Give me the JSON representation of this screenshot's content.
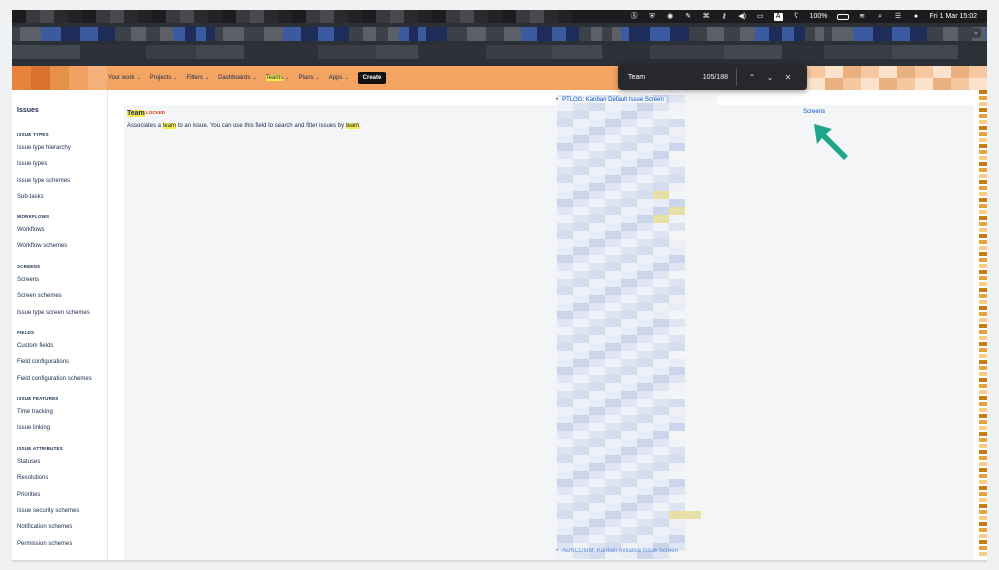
{
  "menubar": {
    "battery": "100%",
    "date_time": "Fri 1 Mar 15:02",
    "status_icons": [
      "s-badge-icon",
      "shield-icon",
      "disc-icon",
      "pin-icon",
      "command-icon",
      "key-icon",
      "volume-icon",
      "battery-icon",
      "keyboard-a-icon",
      "hearing-icon",
      "wifi-icon",
      "search-icon",
      "control-center-icon",
      "siri-icon"
    ],
    "colors": {
      "bg": "#1c1c1e",
      "text": "#ffffff"
    }
  },
  "nav": {
    "items": [
      {
        "label": "Your work",
        "chevron": "⌄",
        "highlighted": false
      },
      {
        "label": "Projects",
        "chevron": "⌄",
        "highlighted": false
      },
      {
        "label": "Filters",
        "chevron": "⌄",
        "highlighted": false
      },
      {
        "label": "Dashboards",
        "chevron": "⌄",
        "highlighted": false
      },
      {
        "label": "Teams",
        "chevron": "⌄",
        "highlighted": true
      },
      {
        "label": "Plans",
        "chevron": "⌄",
        "highlighted": false
      },
      {
        "label": "Apps",
        "chevron": "⌄",
        "highlighted": false
      }
    ],
    "create_label": "Create",
    "colors": {
      "bar": "#f4a462",
      "highlight": "#f6e94a"
    }
  },
  "findbar": {
    "query": "Team",
    "count": "105/188",
    "prev_glyph": "⌃",
    "next_glyph": "⌄",
    "close_glyph": "✕"
  },
  "sidebar": {
    "title": "Issues",
    "sections": [
      {
        "heading": "ISSUE TYPES",
        "items": [
          "Issue type hierarchy",
          "Issue types",
          "Issue type schemes",
          "Sub-tasks"
        ]
      },
      {
        "heading": "WORKFLOWS",
        "items": [
          "Workflows",
          "Workflow schemes"
        ]
      },
      {
        "heading": "SCREENS",
        "items": [
          "Screens",
          "Screen schemes",
          "Issue type screen schemes"
        ]
      },
      {
        "heading": "FIELDS",
        "items": [
          "Custom fields",
          "Field configurations",
          "Field configuration schemes"
        ]
      },
      {
        "heading": "ISSUE FEATURES",
        "items": [
          "Time tracking",
          "Issue linking"
        ]
      },
      {
        "heading": "ISSUE ATTRIBUTES",
        "items": [
          "Statuses",
          "Resolutions",
          "Priorities",
          "Issue security schemes",
          "Notification schemes",
          "Permission schemes"
        ]
      }
    ]
  },
  "field": {
    "name": "Team",
    "badge": "LOCKED",
    "desc_1": "Associates a ",
    "desc_hl_1": "team",
    "desc_2": " to an issue. You can use this field to search and filter issues by ",
    "desc_hl_2": "team",
    "desc_3": "."
  },
  "screens_list": {
    "top_link": "PTLOG: Kanban Default Issue Screen",
    "bottom_link": "ADSCOMM: Kanban Initiative Issue Screen"
  },
  "screens_link": "Screens",
  "colors": {
    "link": "#0052cc",
    "text": "#172b4d",
    "locked": "#de350b",
    "cursor": "#1ea58a"
  }
}
